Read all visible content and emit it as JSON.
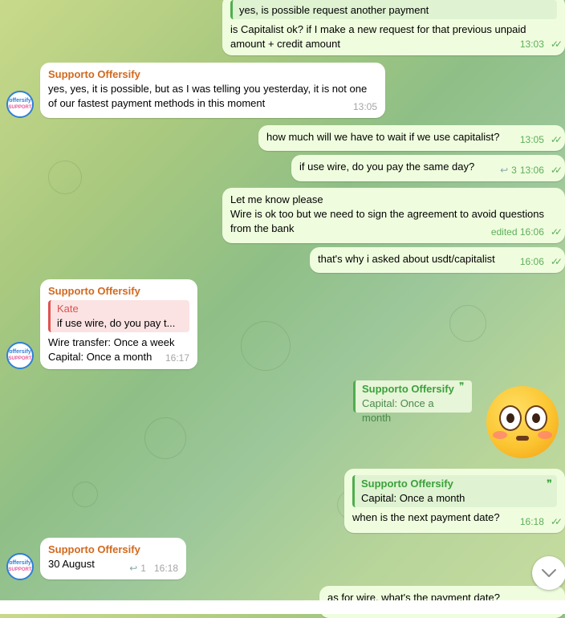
{
  "messages": {
    "m1": {
      "quote": "yes, is possible request another payment",
      "text": "is Capitalist ok? if I make a new request for that previous unpaid amount + credit amount",
      "time": "13:03"
    },
    "m2": {
      "sender": "Supporto Offersify",
      "text": "yes, yes, it is possible, but as I was telling you yesterday, it is not one of our fastest payment methods in this moment",
      "time": "13:05"
    },
    "m3": {
      "text": "how much will we have to wait if we use capitalist?",
      "time": "13:05"
    },
    "m4": {
      "text": "if use wire, do you pay the same day?",
      "replies": "3",
      "time": "13:06"
    },
    "m5": {
      "line1": "Let me know please",
      "line2": "Wire is ok too but we need to sign the agreement to avoid questions from the bank",
      "time": "edited 16:06"
    },
    "m6": {
      "text": "that's why i asked about usdt/capitalist",
      "time": "16:06"
    },
    "m7": {
      "sender": "Supporto Offersify",
      "quote_name": "Kate",
      "quote_text": "if use wire, do you pay t...",
      "line1": "Wire transfer: Once a week",
      "line2": "Capital: Once a month",
      "time": "16:17"
    },
    "m8": {
      "quote_name": "Supporto Offersify",
      "quote_text": "Capital: Once a month"
    },
    "m9": {
      "quote_name": "Supporto Offersify",
      "quote_text": "Capital: Once a month",
      "text": "when is the next payment date?",
      "time": "16:18"
    },
    "m10": {
      "sender": "Supporto Offersify",
      "text": "30 August",
      "replies": "1",
      "time": "16:18"
    },
    "m11": {
      "text": "as for wire, what's the payment date?"
    }
  },
  "avatar": {
    "line1": "offersify",
    "line2": "SUPPORT"
  },
  "icons": {
    "check": "✓✓",
    "reply_arrow": "↩",
    "quote_mark": "❞",
    "scroll_down": "chevron-down-icon"
  }
}
